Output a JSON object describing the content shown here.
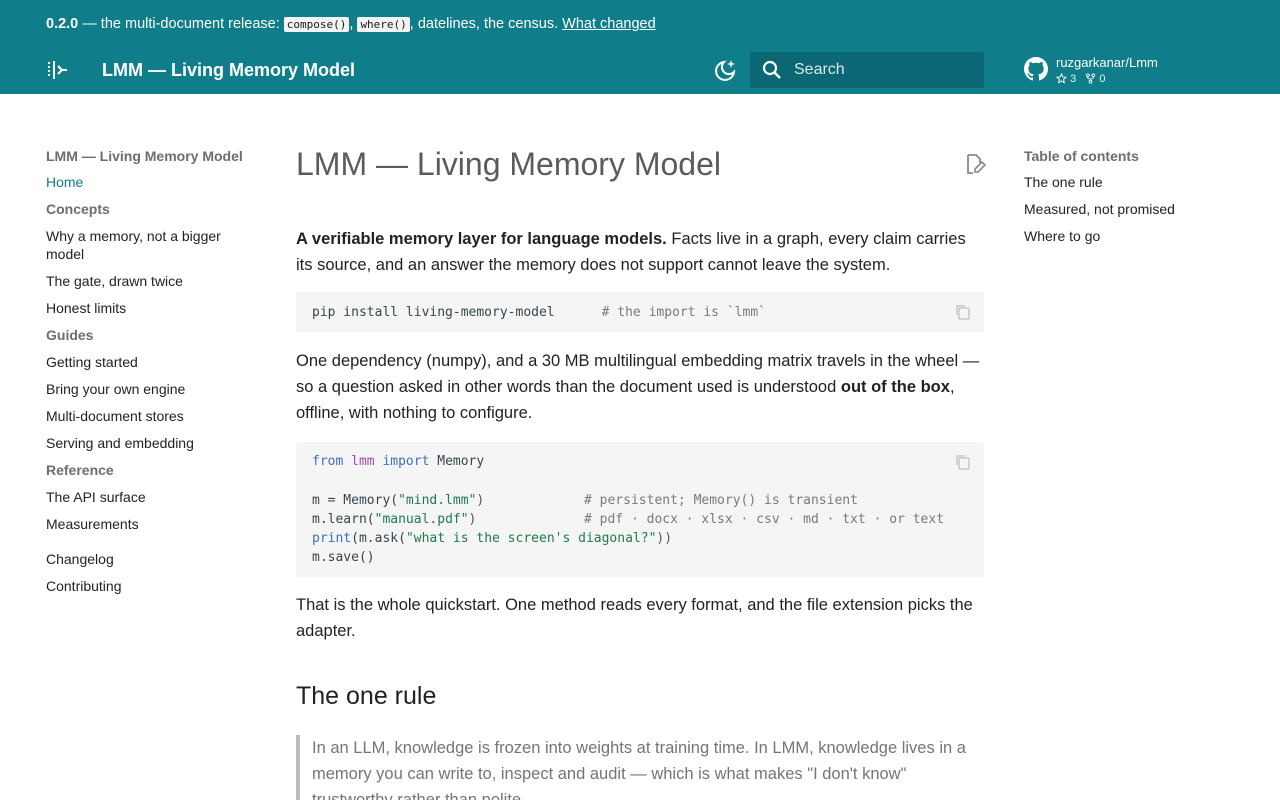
{
  "announcement": {
    "version": "0.2.0",
    "text_before": " — the multi-document release: ",
    "code_1": "compose()",
    "sep": ", ",
    "code_2": "where()",
    "text_after": ", datelines, the census. ",
    "link": "What changed"
  },
  "header": {
    "site_title": "LMM — Living Memory Model",
    "search_placeholder": "Search",
    "repo_name": "ruzgarkanar/Lmm",
    "stars": "3",
    "forks": "0",
    "icons": [
      "sidebar-toggle-icon",
      "theme-toggle-icon",
      "search-icon",
      "github-icon",
      "star-icon",
      "fork-icon"
    ]
  },
  "sidebar": {
    "title": "LMM — Living Memory Model",
    "home": "Home",
    "sections": [
      {
        "title": "Concepts",
        "items": [
          "Why a memory, not a bigger model",
          "The gate, drawn twice",
          "Honest limits"
        ]
      },
      {
        "title": "Guides",
        "items": [
          "Getting started",
          "Bring your own engine",
          "Multi-document stores",
          "Serving and embedding"
        ]
      },
      {
        "title": "Reference",
        "items": [
          "The API surface",
          "Measurements"
        ]
      }
    ],
    "extra": [
      "Changelog",
      "Contributing"
    ]
  },
  "toc": {
    "title": "Table of contents",
    "items": [
      "The one rule",
      "Measured, not promised",
      "Where to go"
    ]
  },
  "main": {
    "title": "LMM — Living Memory Model",
    "p1_bold": "A verifiable memory layer for language models.",
    "p1_rest": " Facts live in a graph, every claim carries its source, and an answer the memory does not support cannot leave the system.",
    "code1": {
      "cmd": "pip install living-memory-model",
      "comment": "# the import is `lmm`"
    },
    "p2_a": "One dependency (numpy), and a 30 MB multilingual embedding matrix travels in the wheel — so a question asked in other words than the document used is understood ",
    "p2_bold": "out of the box",
    "p2_c": ", offline, with nothing to configure.",
    "code2": {
      "l1_from": "from",
      "l1_mod": "lmm",
      "l1_import": "import",
      "l1_name": " Memory",
      "l3_a": "m = Memory(",
      "l3_str": "\"mind.lmm\"",
      "l3_b": ")",
      "l3_comment": "# persistent; Memory() is transient",
      "l4_a": "m.learn(",
      "l4_str": "\"manual.pdf\"",
      "l4_b": ")",
      "l4_comment": "# pdf · docx · xlsx · csv · md · txt · or text",
      "l5_fn": "print",
      "l5_a": "(m.ask(",
      "l5_str": "\"what is the screen's diagonal?\"",
      "l5_b": "))",
      "l6": "m.save()"
    },
    "p3": "That is the whole quickstart. One method reads every format, and the file extension picks the adapter.",
    "h2": "The one rule",
    "quote": "In an LLM, knowledge is frozen into weights at training time. In LMM, knowledge lives in a memory you can write to, inspect and audit — which is what makes \"I don't know\" trustworthy rather than polite."
  }
}
